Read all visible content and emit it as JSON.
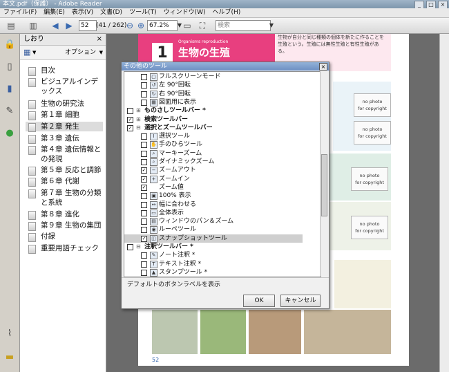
{
  "window": {
    "title": "本文.pdf（保護） - Adobe Reader",
    "min": "_",
    "max": "□",
    "close": "×"
  },
  "menus": [
    "ファイル(F)",
    "編集(E)",
    "表示(V)",
    "文書(D)",
    "ツール(T)",
    "ウィンドウ(W)",
    "ヘルプ(H)"
  ],
  "toolbar": {
    "page": "52",
    "page_count": "(41 / 262)",
    "zoom": "67.2%",
    "search_placeholder": "検索"
  },
  "bookmarks": {
    "title": "しおり",
    "close": "×",
    "options": "オプション",
    "items": [
      "目次",
      "ビジュアルインデックス",
      "生物の研究法",
      "第１章 細胞",
      "第２章 発生",
      "第３章 遺伝",
      "第４章 遺伝情報との発現",
      "第５章 反応と調節",
      "第６章 代謝",
      "第７章 生物の分類と系統",
      "第８章 進化",
      "第９章 生物の集団",
      "付録",
      "重要用語チェック"
    ]
  },
  "page": {
    "chapter_no": "1",
    "chapter_title": "生物の生殖",
    "chapter_en": "Organisms reproduction",
    "caption": "生物が自分と同じ種類の個体を新たに作ることを生殖という。生殖には無性生殖と有性生殖がある。",
    "no_photo": "no photo",
    "for_copyright": "for copyright",
    "footer_page": "52"
  },
  "dialog": {
    "title": "その他のツール",
    "close": "×",
    "rows": [
      {
        "indent": 2,
        "checked": false,
        "icon": "screen-icon",
        "label": "フルスクリーンモード"
      },
      {
        "indent": 2,
        "checked": false,
        "icon": "rotate-left-icon",
        "label": "左 90°回転"
      },
      {
        "indent": 2,
        "checked": false,
        "icon": "rotate-right-icon",
        "label": "右 90°回転"
      },
      {
        "indent": 2,
        "checked": false,
        "icon": "drawing-icon",
        "label": "図面用に表示"
      },
      {
        "indent": 1,
        "checked": false,
        "icon": "",
        "label": "ものさしツールバー *",
        "bold": true,
        "collapsed": true
      },
      {
        "indent": 1,
        "checked": true,
        "icon": "",
        "label": "検索ツールバー",
        "bold": true,
        "collapsed": true
      },
      {
        "indent": 1,
        "checked": true,
        "icon": "",
        "label": "選択とズームツールバー",
        "bold": true,
        "collapsed": false
      },
      {
        "indent": 2,
        "checked": false,
        "icon": "select-icon",
        "label": "選択ツール"
      },
      {
        "indent": 2,
        "checked": false,
        "icon": "hand-icon",
        "label": "手のひらツール"
      },
      {
        "indent": 2,
        "checked": false,
        "icon": "marquee-zoom-icon",
        "label": "マーキーズーム"
      },
      {
        "indent": 2,
        "checked": false,
        "icon": "dynamic-zoom-icon",
        "label": "ダイナミックズーム"
      },
      {
        "indent": 2,
        "checked": true,
        "icon": "zoom-out-icon",
        "label": "ズームアウト"
      },
      {
        "indent": 2,
        "checked": true,
        "icon": "zoom-in-icon",
        "label": "ズームイン"
      },
      {
        "indent": 2,
        "checked": true,
        "icon": "",
        "label": "ズーム値"
      },
      {
        "indent": 2,
        "checked": false,
        "icon": "actual-size-icon",
        "label": "100% 表示"
      },
      {
        "indent": 2,
        "checked": false,
        "icon": "fit-width-icon",
        "label": "幅に合わせる"
      },
      {
        "indent": 2,
        "checked": false,
        "icon": "fit-page-icon",
        "label": "全体表示"
      },
      {
        "indent": 2,
        "checked": false,
        "icon": "pan-zoom-icon",
        "label": "ウィンドウのパン＆ズーム"
      },
      {
        "indent": 2,
        "checked": false,
        "icon": "loupe-icon",
        "label": "ルーペツール"
      },
      {
        "indent": 2,
        "checked": true,
        "icon": "snapshot-icon",
        "label": "スナップショットツール",
        "highlight": true
      },
      {
        "indent": 1,
        "checked": false,
        "icon": "",
        "label": "注釈ツールバー *",
        "bold": true,
        "collapsed": false
      },
      {
        "indent": 2,
        "checked": false,
        "icon": "note-icon",
        "label": "ノート注釈 *"
      },
      {
        "indent": 2,
        "checked": false,
        "icon": "text-comment-icon",
        "label": "テキスト注釈 *"
      },
      {
        "indent": 2,
        "checked": false,
        "icon": "stamp-icon",
        "label": "スタンプツール *"
      }
    ],
    "status": "デフォルトのボタンラベルを表示",
    "ok": "OK",
    "cancel": "キャンセル"
  },
  "colors": {
    "accent_pink": "#e83f7f",
    "dialog_title": "#6d8fc2"
  }
}
